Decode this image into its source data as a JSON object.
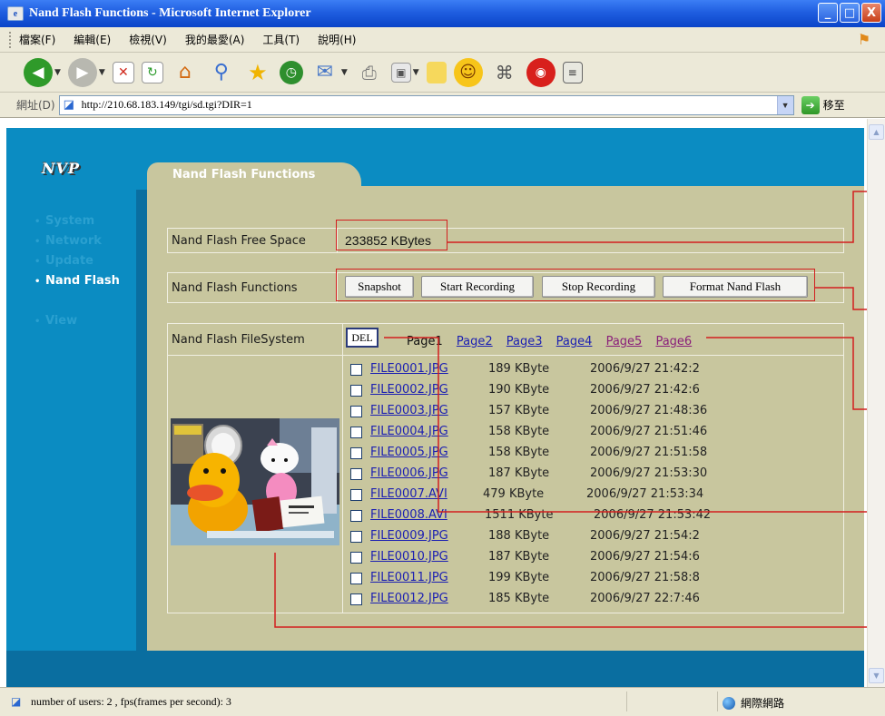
{
  "window": {
    "title": "Nand Flash Functions - Microsoft Internet Explorer",
    "controls": [
      "_",
      "□",
      "X"
    ]
  },
  "menu": [
    "檔案(F)",
    "編輯(E)",
    "檢視(V)",
    "我的最愛(A)",
    "工具(T)",
    "說明(H)"
  ],
  "address": {
    "label": "網址(D)",
    "url": "http://210.68.183.149/tgi/sd.tgi?DIR=1",
    "go_label": "移至"
  },
  "page": {
    "logo": "NVP",
    "tab_title": "Nand Flash Functions",
    "nav": [
      {
        "label": "System",
        "active": false
      },
      {
        "label": "Network",
        "active": false
      },
      {
        "label": "Update",
        "active": false
      },
      {
        "label": "Nand Flash",
        "active": true
      },
      {
        "label": "View",
        "active": false
      }
    ],
    "free_space": {
      "label": "Nand Flash Free Space",
      "value": "233852 KBytes"
    },
    "functions": {
      "label": "Nand Flash Functions",
      "buttons": [
        "Snapshot",
        "Start Recording",
        "Stop Recording",
        "Format Nand Flash"
      ]
    },
    "filesystem": {
      "label": "Nand Flash FileSystem",
      "del_label": "DEL",
      "pages": [
        "Page1",
        "Page2",
        "Page3",
        "Page4",
        "Page5",
        "Page6"
      ],
      "files": [
        {
          "name": "FILE0001.JPG",
          "size": "189 KByte",
          "date": "2006/9/27 21:42:2"
        },
        {
          "name": "FILE0002.JPG",
          "size": "190 KByte",
          "date": "2006/9/27 21:42:6"
        },
        {
          "name": "FILE0003.JPG",
          "size": "157 KByte",
          "date": "2006/9/27 21:48:36"
        },
        {
          "name": "FILE0004.JPG",
          "size": "158 KByte",
          "date": "2006/9/27 21:51:46"
        },
        {
          "name": "FILE0005.JPG",
          "size": "158 KByte",
          "date": "2006/9/27 21:51:58"
        },
        {
          "name": "FILE0006.JPG",
          "size": "187 KByte",
          "date": "2006/9/27 21:53:30"
        },
        {
          "name": "FILE0007.AVI",
          "size": "479 KByte",
          "date": "2006/9/27 21:53:34"
        },
        {
          "name": "FILE0008.AVI",
          "size": "1511 KByte",
          "date": "2006/9/27 21:53:42"
        },
        {
          "name": "FILE0009.JPG",
          "size": "188 KByte",
          "date": "2006/9/27 21:54:2"
        },
        {
          "name": "FILE0010.JPG",
          "size": "187 KByte",
          "date": "2006/9/27 21:54:6"
        },
        {
          "name": "FILE0011.JPG",
          "size": "199 KByte",
          "date": "2006/9/27 21:58:8"
        },
        {
          "name": "FILE0012.JPG",
          "size": "185 KByte",
          "date": "2006/9/27 22:7:46"
        }
      ]
    }
  },
  "status": {
    "text": "number of users: 2 ,  fps(frames per second): 3",
    "zone": "網際網路"
  },
  "colors": {
    "page_blue": "#0b8cc2",
    "panel": "#c8c69e",
    "callout_red": "#d21f1f",
    "link": "#1b1fb2",
    "visited": "#8a1f7a"
  }
}
